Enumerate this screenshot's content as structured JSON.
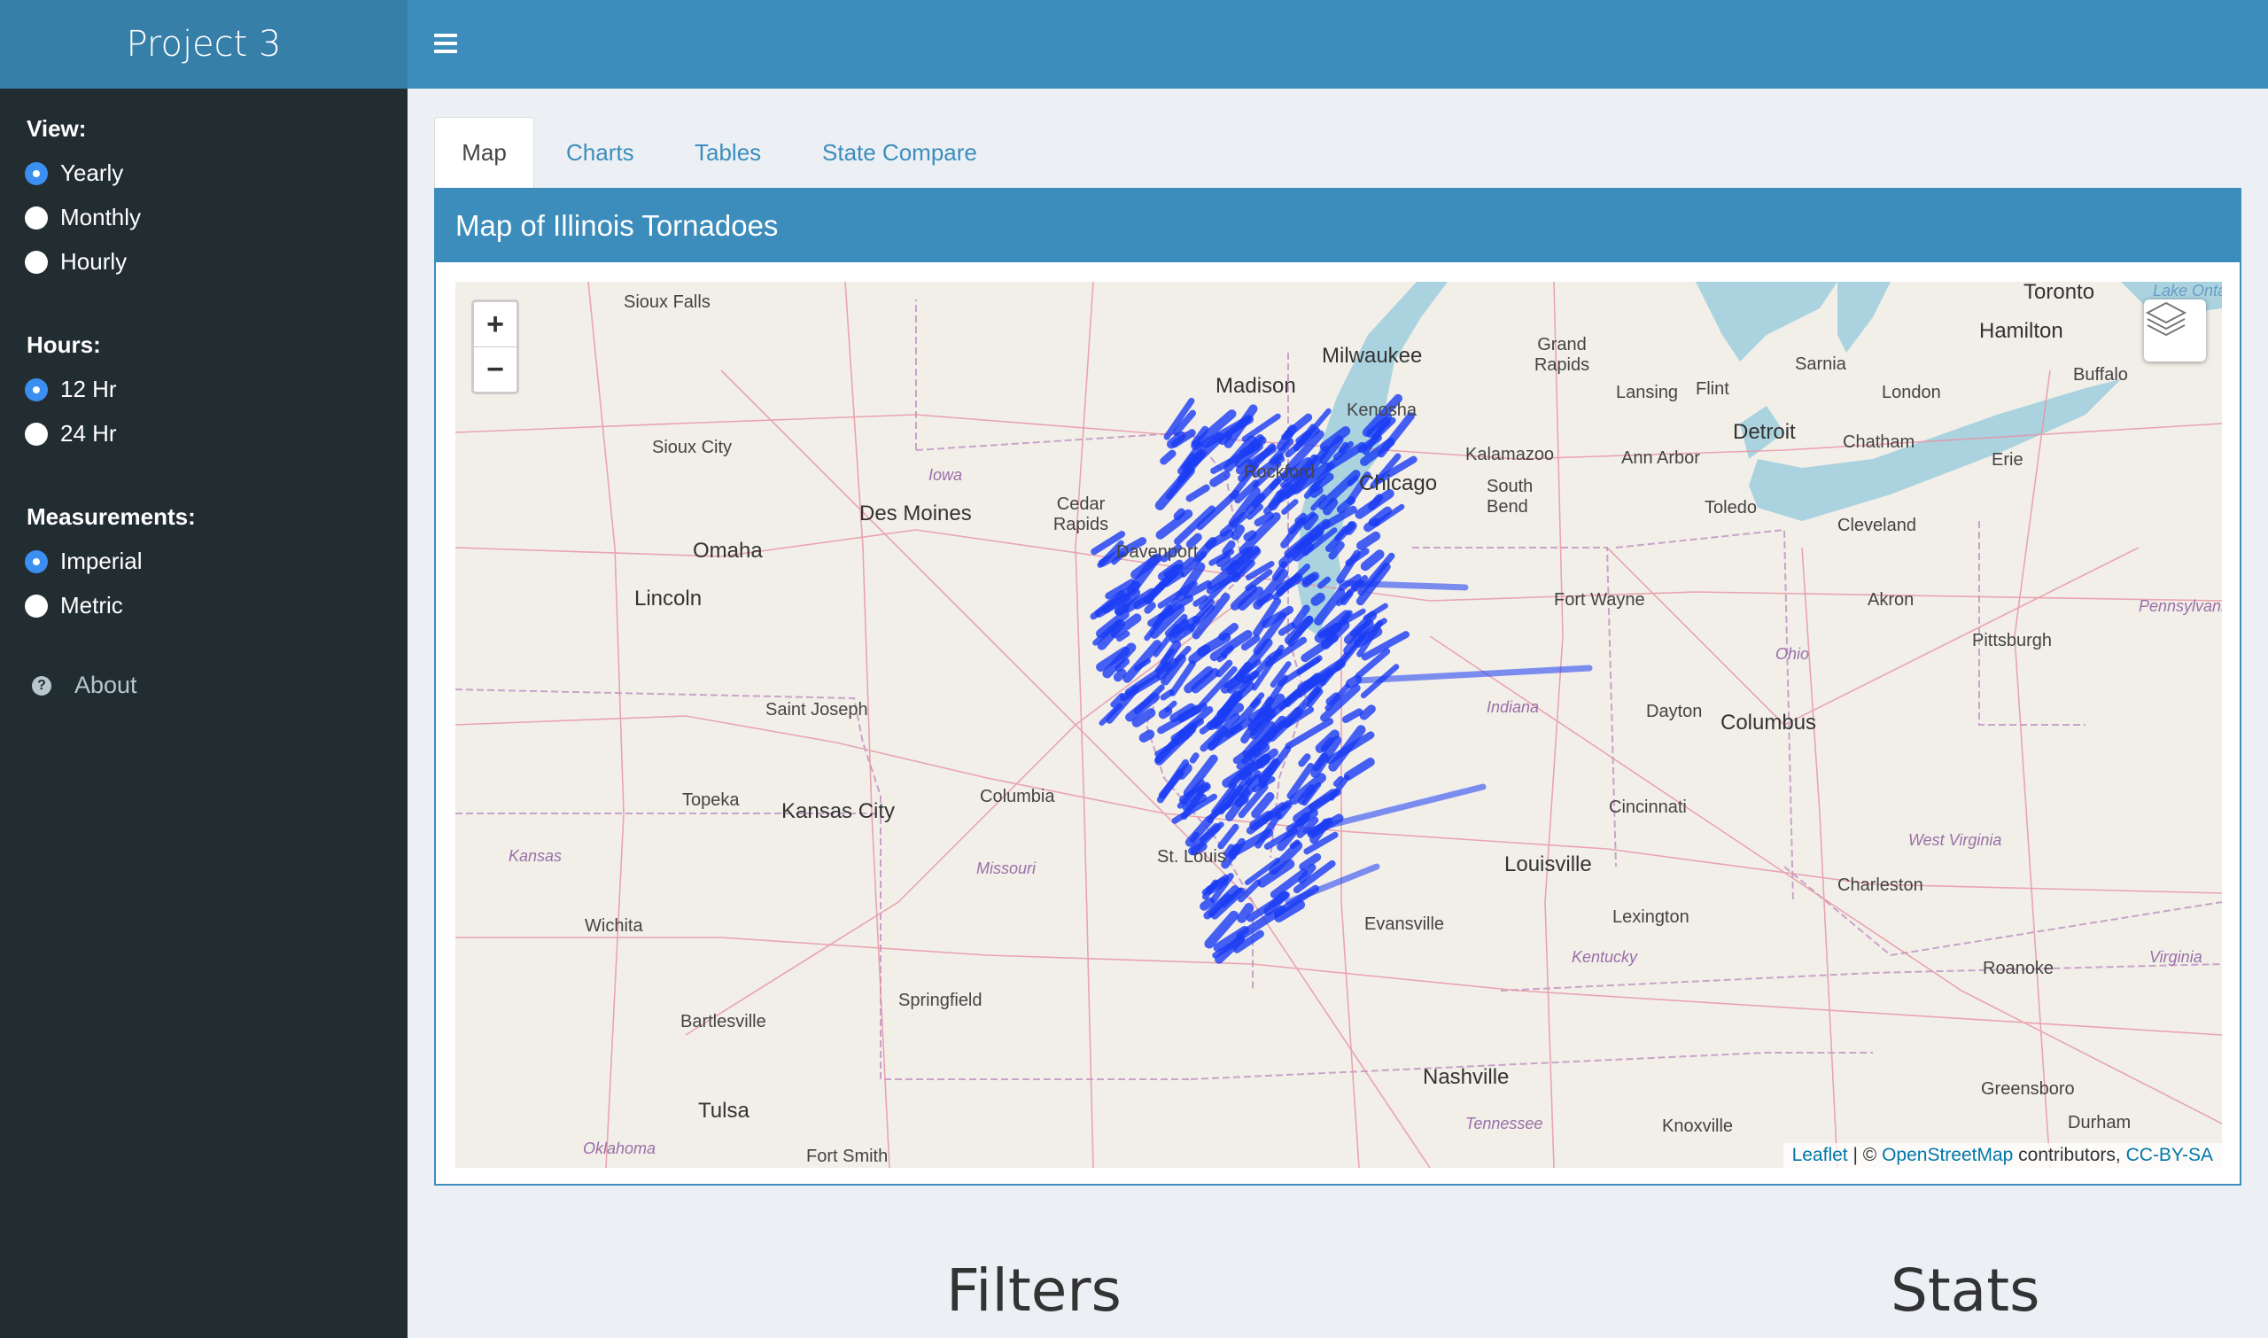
{
  "app": {
    "title": "Project 3"
  },
  "sidebar": {
    "groups": [
      {
        "label": "View:",
        "options": [
          {
            "label": "Yearly",
            "checked": true
          },
          {
            "label": "Monthly",
            "checked": false
          },
          {
            "label": "Hourly",
            "checked": false
          }
        ]
      },
      {
        "label": "Hours:",
        "options": [
          {
            "label": "12 Hr",
            "checked": true
          },
          {
            "label": "24 Hr",
            "checked": false
          }
        ]
      },
      {
        "label": "Measurements:",
        "options": [
          {
            "label": "Imperial",
            "checked": true
          },
          {
            "label": "Metric",
            "checked": false
          }
        ]
      }
    ],
    "about": "About"
  },
  "tabs": [
    {
      "label": "Map",
      "active": true
    },
    {
      "label": "Charts",
      "active": false
    },
    {
      "label": "Tables",
      "active": false
    },
    {
      "label": "State Compare",
      "active": false
    }
  ],
  "map_box": {
    "title": "Map of Illinois Tornadoes",
    "zoom_in": "+",
    "zoom_out": "−",
    "attribution": {
      "leaflet": "Leaflet",
      "sep": " | © ",
      "osm": "OpenStreetMap",
      "contrib": " contributors, ",
      "license": "CC-BY-SA"
    },
    "cities": [
      "Sioux Falls",
      "Milwaukee",
      "Madison",
      "Grand Rapids",
      "Lansing",
      "Flint",
      "Sarnia",
      "Toronto",
      "Hamilton",
      "Buffalo",
      "London",
      "Kenosha",
      "Detroit",
      "Chatham",
      "Kalamazoo",
      "Ann Arbor",
      "Erie",
      "Sioux City",
      "Rockford",
      "Chicago",
      "South Bend",
      "Toledo",
      "Cleveland",
      "Des Moines",
      "Cedar Rapids",
      "Omaha",
      "Davenport",
      "Fort Wayne",
      "Akron",
      "Lincoln",
      "Pittsburgh",
      "Saint Joseph",
      "Dayton",
      "Columbus",
      "Topeka",
      "Kansas City",
      "Columbia",
      "Cincinnati",
      "St. Louis",
      "Louisville",
      "Charleston",
      "Wichita",
      "Evansville",
      "Lexington",
      "Roanoke",
      "Springfield",
      "Bartlesville",
      "Nashville",
      "Greensboro",
      "Tulsa",
      "Knoxville",
      "Durham",
      "Fort Smith"
    ],
    "states": [
      "Iowa",
      "Ohio",
      "Indiana",
      "Kansas",
      "Missouri",
      "West Virginia",
      "Kentucky",
      "Virginia",
      "Tennessee",
      "Oklahoma",
      "Pennsylvania"
    ],
    "lakes": [
      "Lake Ontario"
    ]
  },
  "sections": {
    "filters": "Filters",
    "stats": "Stats"
  },
  "colors": {
    "accent": "#3c8dbc",
    "sidebar": "#222d32",
    "track": "#1a3cf5"
  },
  "icons": {
    "menu": "hamburger-icon",
    "about": "question-circle-icon",
    "layers": "layers-icon"
  }
}
